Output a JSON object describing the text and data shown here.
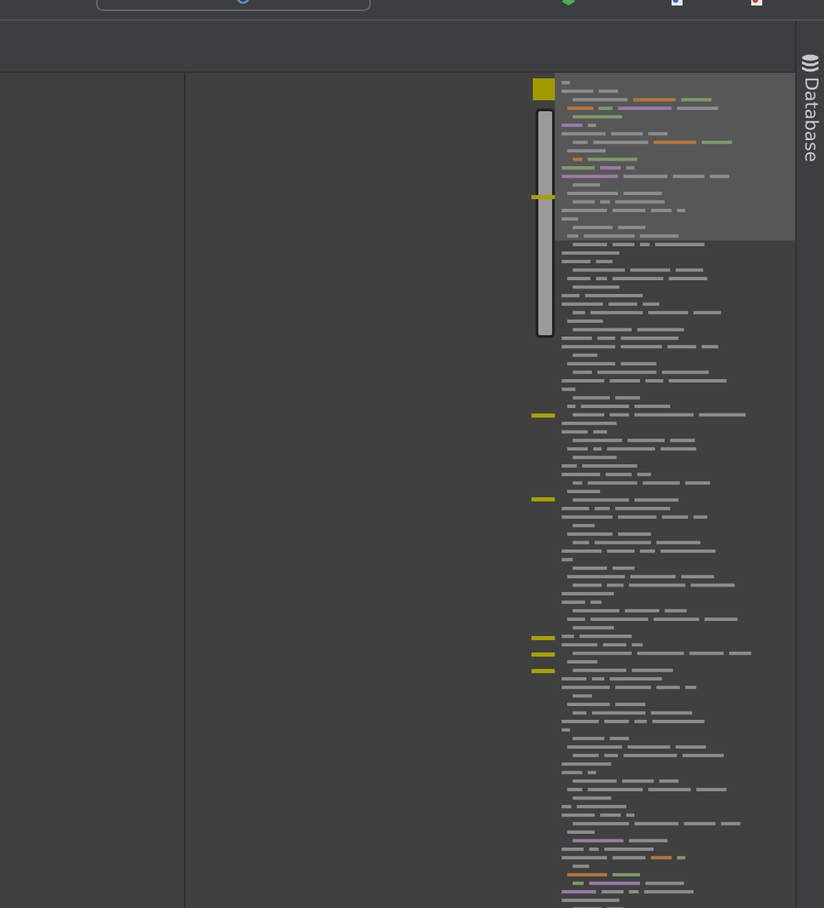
{
  "right_tool_strip": {
    "tool_window_button": {
      "label": "Database"
    }
  }
}
